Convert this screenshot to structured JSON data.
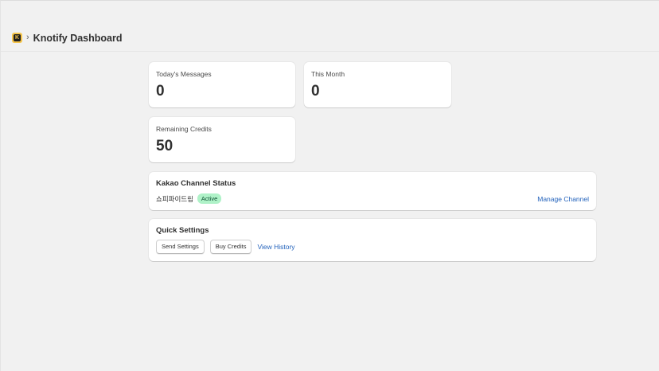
{
  "header": {
    "app_icon_letter": "K",
    "separator": "›",
    "title": "Knotify Dashboard"
  },
  "stats": {
    "today": {
      "label": "Today's Messages",
      "value": "0"
    },
    "month": {
      "label": "This Month",
      "value": "0"
    },
    "credits": {
      "label": "Remaining Credits",
      "value": "50"
    }
  },
  "kakao": {
    "title": "Kakao Channel Status",
    "channel_name": "쇼피파이드림",
    "status": "Active",
    "manage_label": "Manage Channel"
  },
  "quick": {
    "title": "Quick Settings",
    "send_settings_label": "Send Settings",
    "buy_credits_label": "Buy Credits",
    "view_history_label": "View History"
  },
  "colors": {
    "background": "#f1f1f1",
    "link": "#2463bc",
    "badge_bg": "#aff2c8",
    "app_icon": "#f6c54a"
  }
}
